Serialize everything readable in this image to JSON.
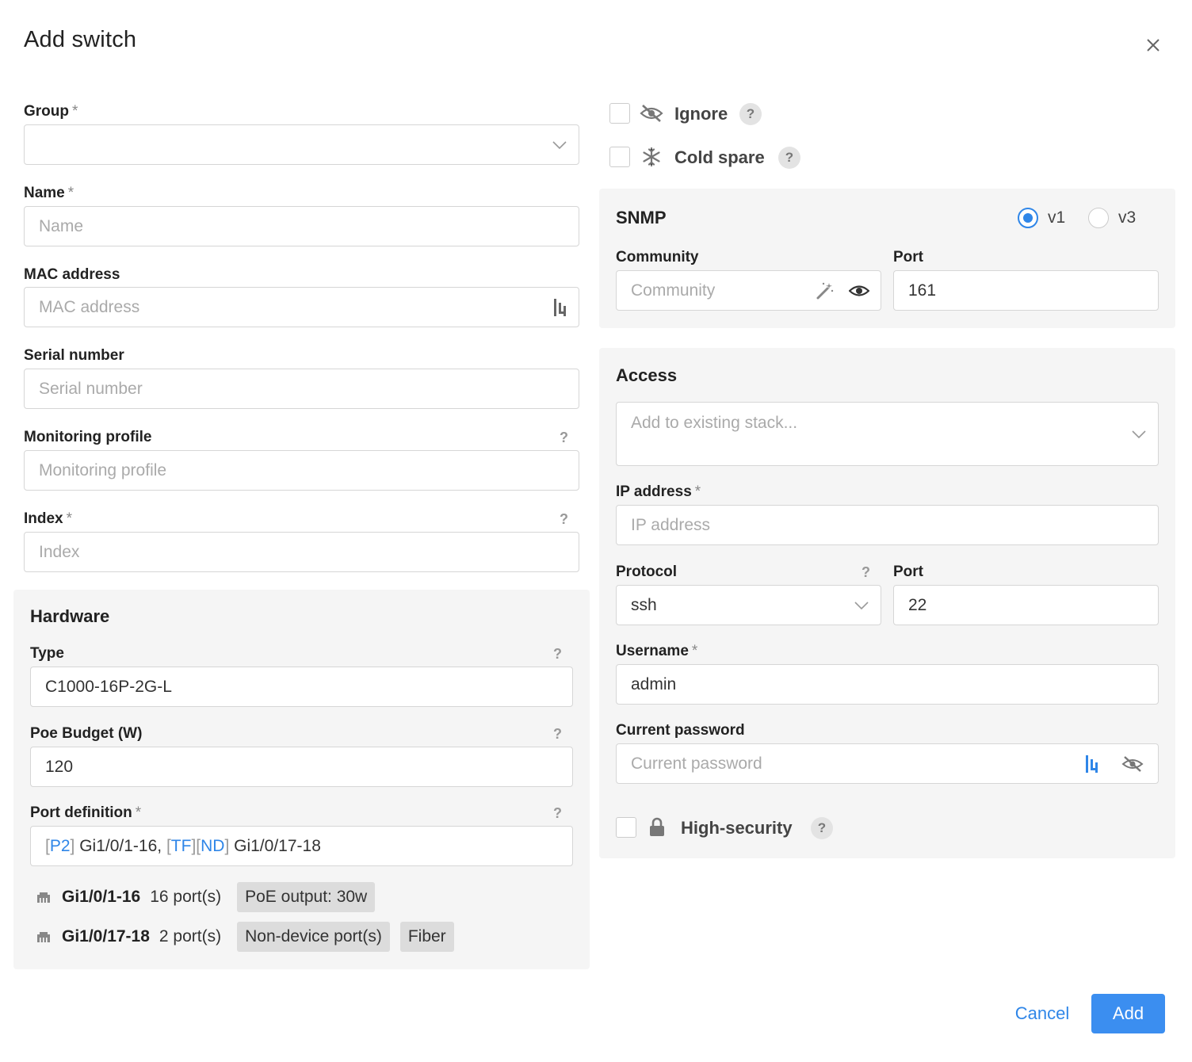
{
  "dialog": {
    "title": "Add switch"
  },
  "left": {
    "group": {
      "label": "Group",
      "required": "*",
      "value": ""
    },
    "name": {
      "label": "Name",
      "required": "*",
      "placeholder": "Name"
    },
    "mac": {
      "label": "MAC address",
      "placeholder": "MAC address"
    },
    "serial": {
      "label": "Serial number",
      "placeholder": "Serial number"
    },
    "monitoring": {
      "label": "Monitoring profile",
      "help": "?",
      "placeholder": "Monitoring profile"
    },
    "index": {
      "label": "Index",
      "required": "*",
      "help": "?",
      "placeholder": "Index"
    }
  },
  "hardware": {
    "title": "Hardware",
    "type": {
      "label": "Type",
      "help": "?",
      "value": "C1000-16P-2G-L"
    },
    "poe": {
      "label": "Poe Budget (W)",
      "help": "?",
      "value": "120"
    },
    "port_def": {
      "label": "Port definition",
      "required": "*",
      "help": "?",
      "segments": {
        "b1": "[",
        "t1": "P2",
        "b2": "]",
        "s1": " Gi1/0/1-16, ",
        "b3": "[",
        "t2": "TF",
        "b4": "][",
        "t3": "ND",
        "b5": "]",
        "s2": " Gi1/0/17-18"
      }
    },
    "ports": [
      {
        "name": "Gi1/0/1-16",
        "count": "16 port(s)",
        "tags": [
          "PoE output: 30w"
        ]
      },
      {
        "name": "Gi1/0/17-18",
        "count": "2 port(s)",
        "tags": [
          "Non-device port(s)",
          "Fiber"
        ]
      }
    ]
  },
  "flags": {
    "ignore": {
      "label": "Ignore",
      "help": "?",
      "checked": false
    },
    "cold_spare": {
      "label": "Cold spare",
      "help": "?",
      "checked": false
    }
  },
  "snmp": {
    "title": "SNMP",
    "versions": [
      {
        "label": "v1",
        "selected": true
      },
      {
        "label": "v3",
        "selected": false
      }
    ],
    "community": {
      "label": "Community",
      "placeholder": "Community"
    },
    "port": {
      "label": "Port",
      "value": "161"
    }
  },
  "access": {
    "title": "Access",
    "stack": {
      "placeholder": "Add to existing stack..."
    },
    "ip": {
      "label": "IP address",
      "required": "*",
      "placeholder": "IP address"
    },
    "protocol": {
      "label": "Protocol",
      "help": "?",
      "value": "ssh"
    },
    "port": {
      "label": "Port",
      "value": "22"
    },
    "username": {
      "label": "Username",
      "required": "*",
      "value": "admin"
    },
    "password": {
      "label": "Current password",
      "placeholder": "Current password"
    },
    "high_security": {
      "label": "High-security",
      "help": "?",
      "checked": false
    }
  },
  "footer": {
    "cancel": "Cancel",
    "add": "Add"
  },
  "colors": {
    "accent": "#2f86e8",
    "primary_button": "#3b8ef0",
    "panel_bg": "#f5f5f5"
  },
  "icons": [
    "close-icon",
    "chevron-down-icon",
    "keypass-icon",
    "eye-slash-icon",
    "snowflake-icon",
    "magic-wand-icon",
    "eye-icon",
    "lock-icon",
    "ethernet-port-icon"
  ]
}
